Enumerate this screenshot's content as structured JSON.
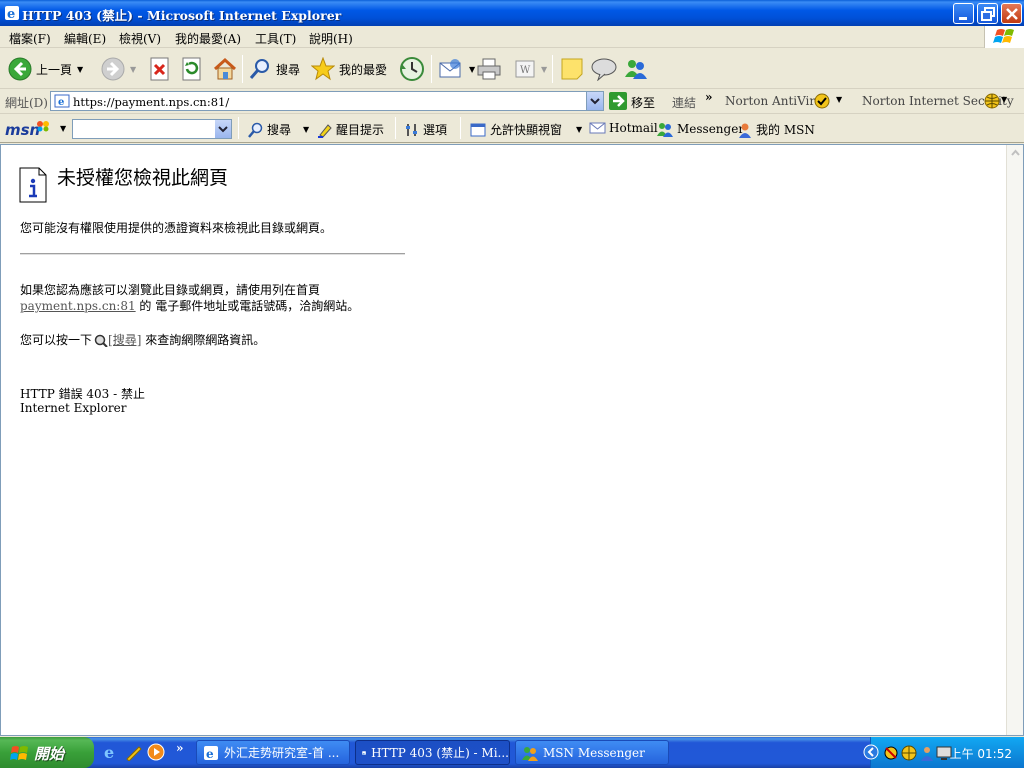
{
  "window": {
    "title": "HTTP 403 (禁止) - Microsoft Internet Explorer"
  },
  "menu": [
    "檔案(F)",
    "編輯(E)",
    "檢視(V)",
    "我的最愛(A)",
    "工具(T)",
    "說明(H)"
  ],
  "toolbar": {
    "back_label": "上一頁",
    "search_label": "搜尋",
    "favorites_label": "我的最愛"
  },
  "address": {
    "label": "網址(D)",
    "url": "https://payment.nps.cn:81/",
    "go_label": "移至",
    "links_label": "連結",
    "norton_antivirus": "Norton AntiVirus",
    "norton_security": "Norton Internet Security"
  },
  "msn": {
    "logo": "msn",
    "search_label": "搜尋",
    "highlight_label": "醒目提示",
    "options_label": "選項",
    "popup_label": "允許快顯視窗",
    "hotmail_label": "Hotmail",
    "messenger_label": "Messenger",
    "mymsn_label": "我的 MSN"
  },
  "content": {
    "title": "未授權您檢視此網頁",
    "line1": "您可能沒有權限使用提供的憑證資料來檢視此目錄或網頁。",
    "line2": "如果您認為應該可以瀏覽此目錄或網頁，請使用列在首頁",
    "line3_link": "payment.nps.cn:81",
    "line3_rest": " 的 電子郵件地址或電話號碼，洽詢網站。",
    "line4_pre": "您可以按一下",
    "line4_link": "[搜尋]",
    "line4_post": " 來查詢網際網路資訊。",
    "error_code": "HTTP 錯誤 403 - 禁止",
    "error_source": "Internet Explorer"
  },
  "taskbar": {
    "start_label": "開始",
    "tasks": [
      {
        "label": "外汇走势研究室-首 ..."
      },
      {
        "label": "HTTP 403 (禁止) - Mi..."
      },
      {
        "label": "MSN Messenger"
      }
    ],
    "clock": "上午 01:52"
  },
  "colors": {
    "titlebar": "#0058e6",
    "taskbar": "#2157d7",
    "start_button": "#39a039",
    "tray": "#0f8fe0"
  }
}
